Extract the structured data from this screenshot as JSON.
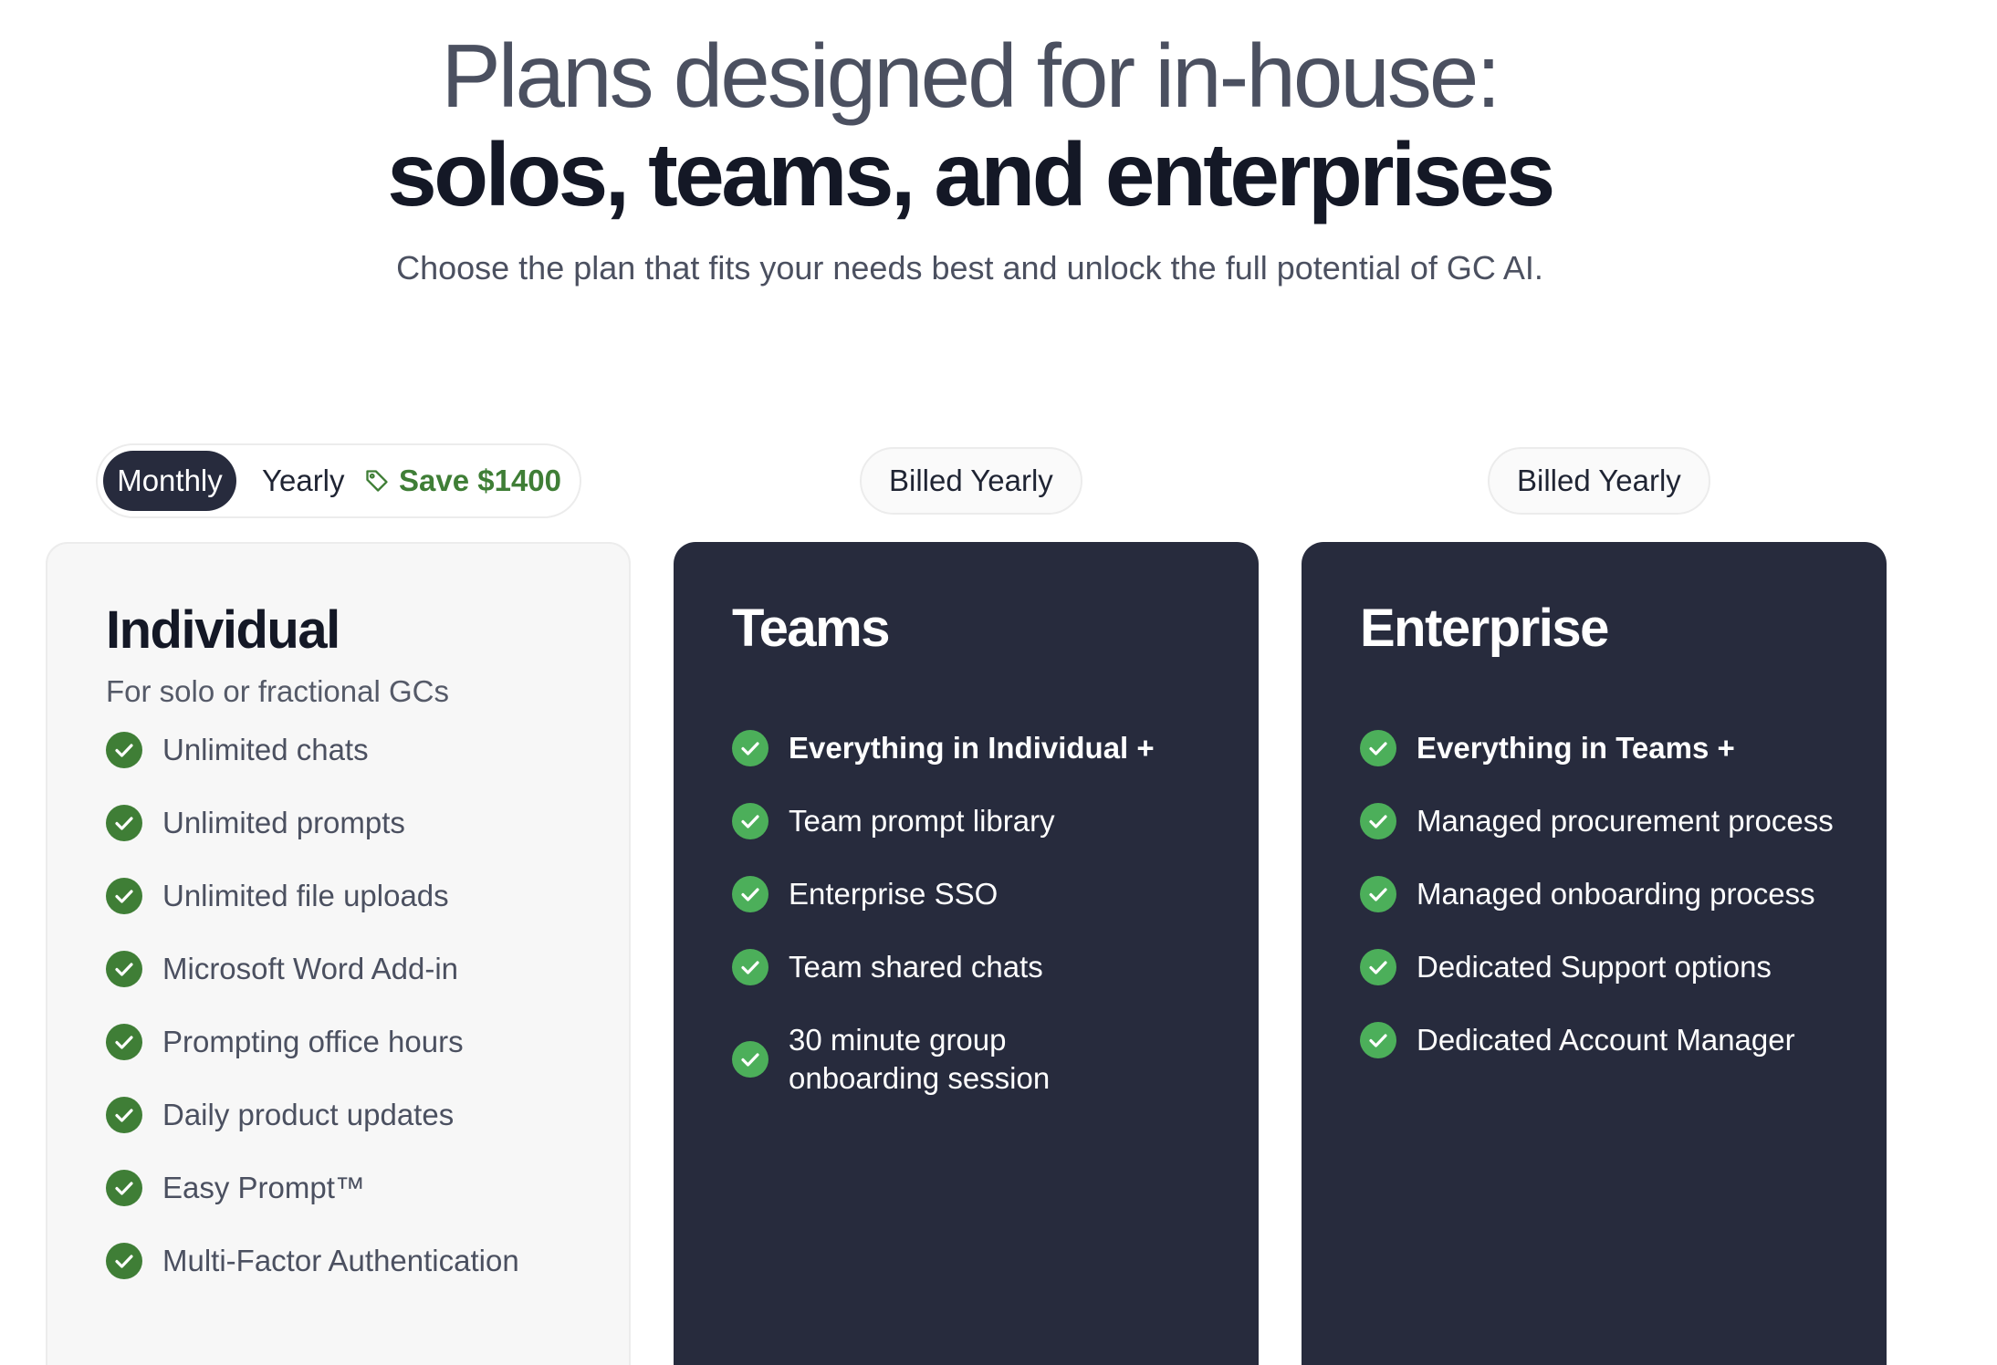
{
  "hero": {
    "line1": "Plans designed for in-house:",
    "line2": "solos, teams, and enterprises",
    "subtitle": "Choose the plan that fits your needs best and unlock the full potential of GC AI."
  },
  "billing_toggle": {
    "monthly_label": "Monthly",
    "yearly_label": "Yearly",
    "save_label": "Save $1400",
    "selected": "Monthly",
    "save_icon": "tag-icon"
  },
  "colors": {
    "dark_card": "#272b3d",
    "check_green": "#3f7e36",
    "check_green_dark_card": "#4caf5a"
  },
  "plans": [
    {
      "name": "Individual",
      "subtitle": "For solo or fractional GCs",
      "features": [
        "Unlimited chats",
        "Unlimited prompts",
        "Unlimited file uploads",
        "Microsoft Word Add-in",
        "Prompting office hours",
        "Daily product updates",
        "Easy Prompt™",
        "Multi-Factor Authentication"
      ]
    },
    {
      "name": "Teams",
      "billing_note": "Billed Yearly",
      "features": [
        "Everything in Individual +",
        "Team prompt library",
        "Enterprise SSO",
        "Team shared chats",
        "30 minute group onboarding session"
      ]
    },
    {
      "name": "Enterprise",
      "billing_note": "Billed Yearly",
      "features": [
        "Everything in Teams +",
        "Managed procurement process",
        "Managed onboarding process",
        "Dedicated Support options",
        "Dedicated Account Manager"
      ]
    }
  ]
}
